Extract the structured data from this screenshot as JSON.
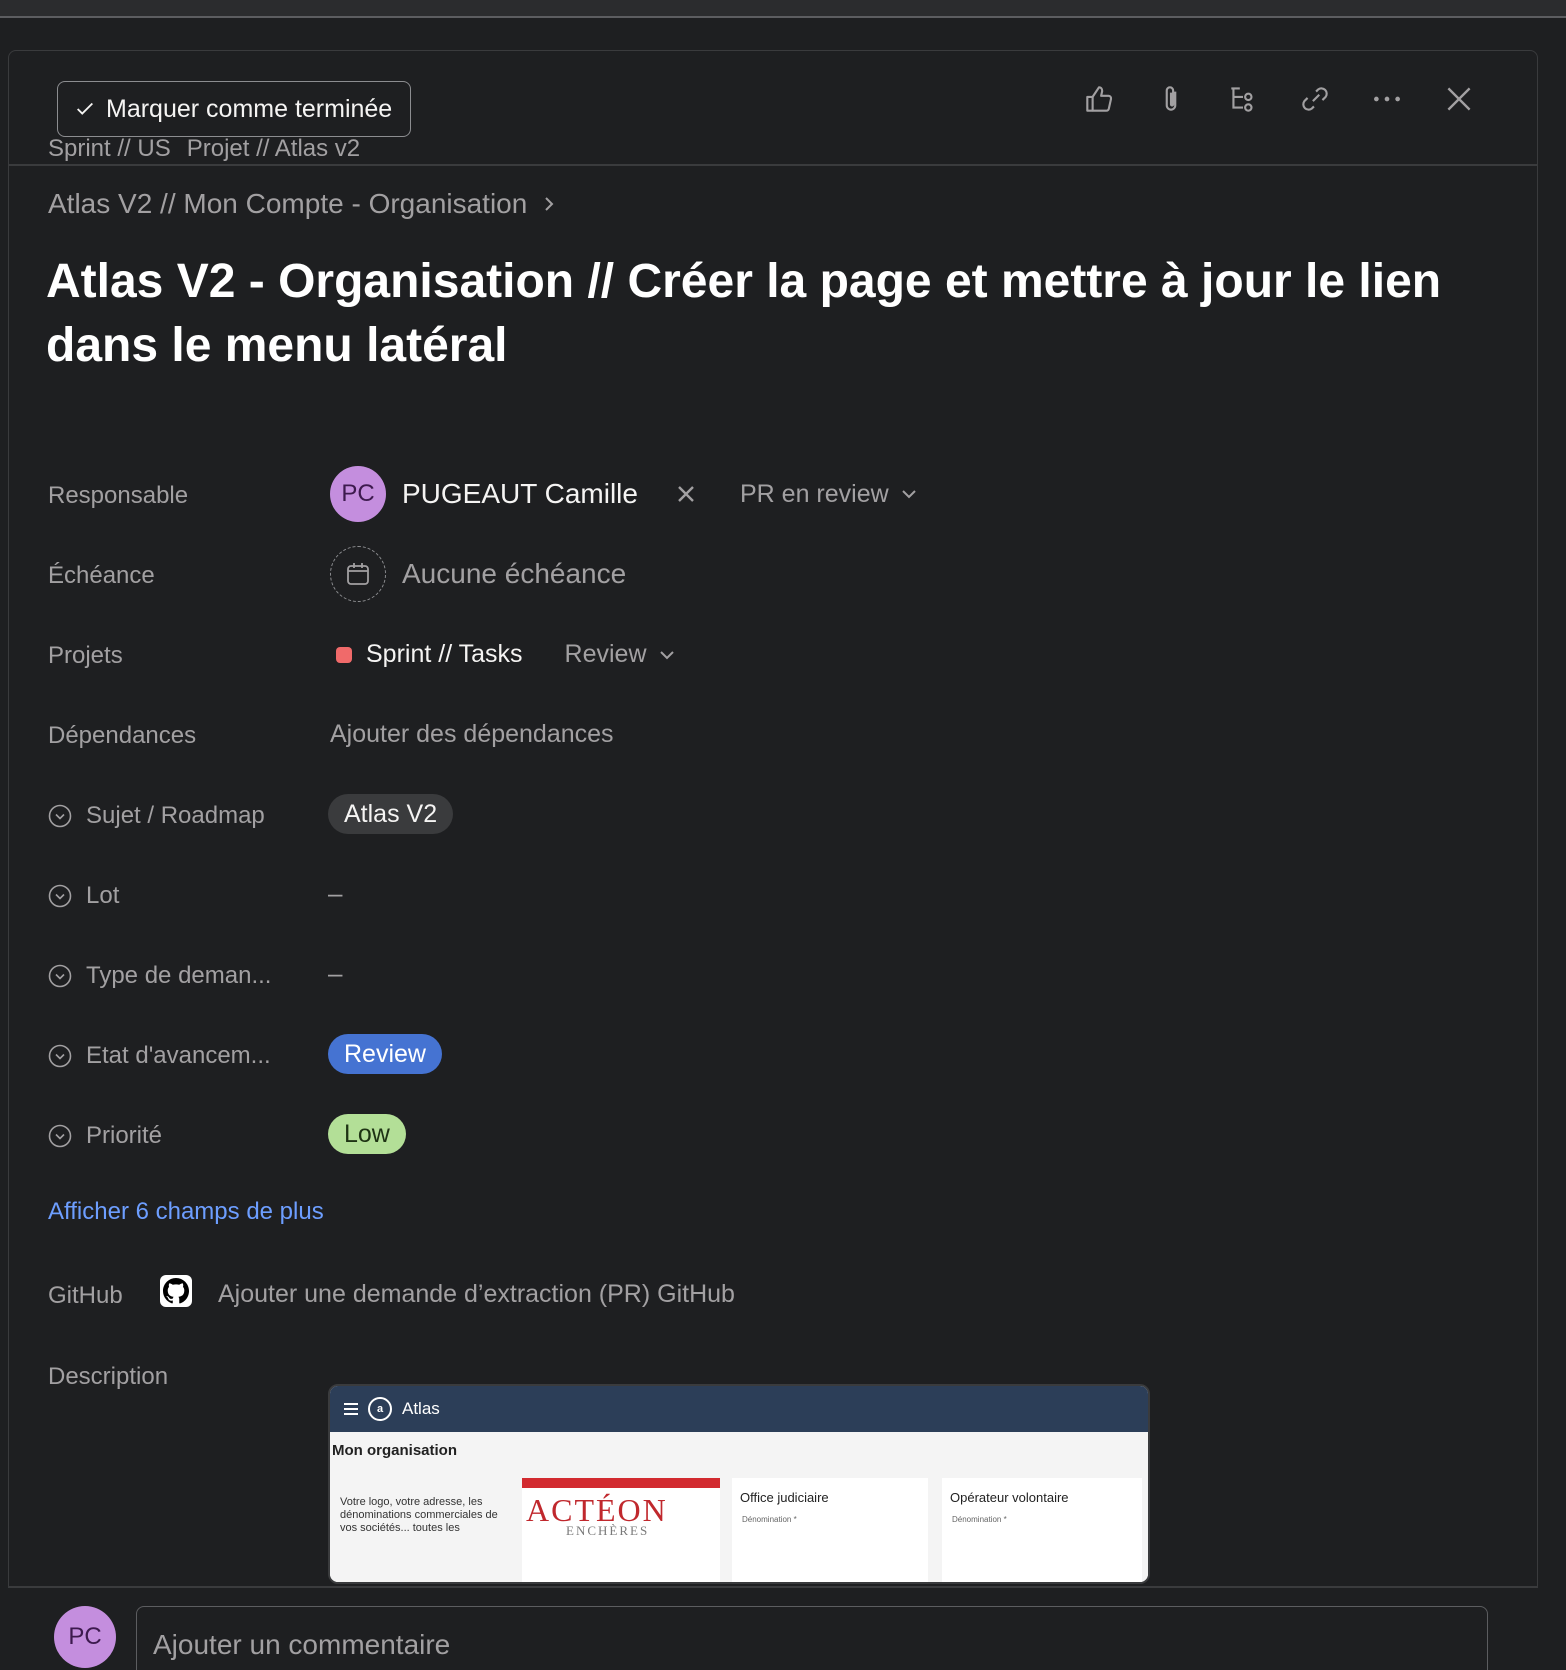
{
  "header": {
    "mark_complete_label": "Marquer comme terminée",
    "icons": [
      "thumbs-up-icon",
      "paperclip-icon",
      "subtask-icon",
      "link-icon",
      "more-icon",
      "close-icon"
    ]
  },
  "breadcrumb": [
    "Sprint // US",
    "Projet // Atlas v2"
  ],
  "parent_task": "Atlas V2 // Mon Compte - Organisation",
  "title": "Atlas V2 - Organisation // Créer la page et mettre à jour le lien dans le menu latéral",
  "fields": {
    "assignee": {
      "label": "Responsable",
      "initials": "PC",
      "name": "PUGEAUT Camille",
      "status": "PR en review"
    },
    "due": {
      "label": "Échéance",
      "value": "Aucune échéance"
    },
    "projects": {
      "label": "Projets",
      "name": "Sprint // Tasks",
      "section": "Review",
      "color": "#f06a6a"
    },
    "dependencies": {
      "label": "Dépendances",
      "value": "Ajouter des dépendances"
    },
    "subject": {
      "label": "Sujet / Roadmap",
      "value": "Atlas V2"
    },
    "lot": {
      "label": "Lot",
      "value": "–"
    },
    "request_type": {
      "label": "Type de deman...",
      "value": "–"
    },
    "progress_state": {
      "label": "Etat d'avancem...",
      "value": "Review",
      "color": "#4573d2"
    },
    "priority": {
      "label": "Priorité",
      "value": "Low",
      "color": "#b3df97"
    }
  },
  "more_fields_link": "Afficher 6 champs de plus",
  "github": {
    "label": "GitHub",
    "action": "Ajouter une demande d’extraction (PR) GitHub"
  },
  "description": {
    "label": "Description",
    "embed": {
      "app_name": "Atlas",
      "page_title": "Mon organisation",
      "intro": "Votre logo, votre adresse, les dénominations commerciales de vos sociétés... toutes les",
      "brand": "ACTÉON",
      "brand_sub": "ENCHÈRES",
      "card2_title": "Office judiciaire",
      "card3_title": "Opérateur volontaire",
      "field_label": "Dénomination *"
    }
  },
  "comment": {
    "initials": "PC",
    "placeholder": "Ajouter un commentaire"
  }
}
